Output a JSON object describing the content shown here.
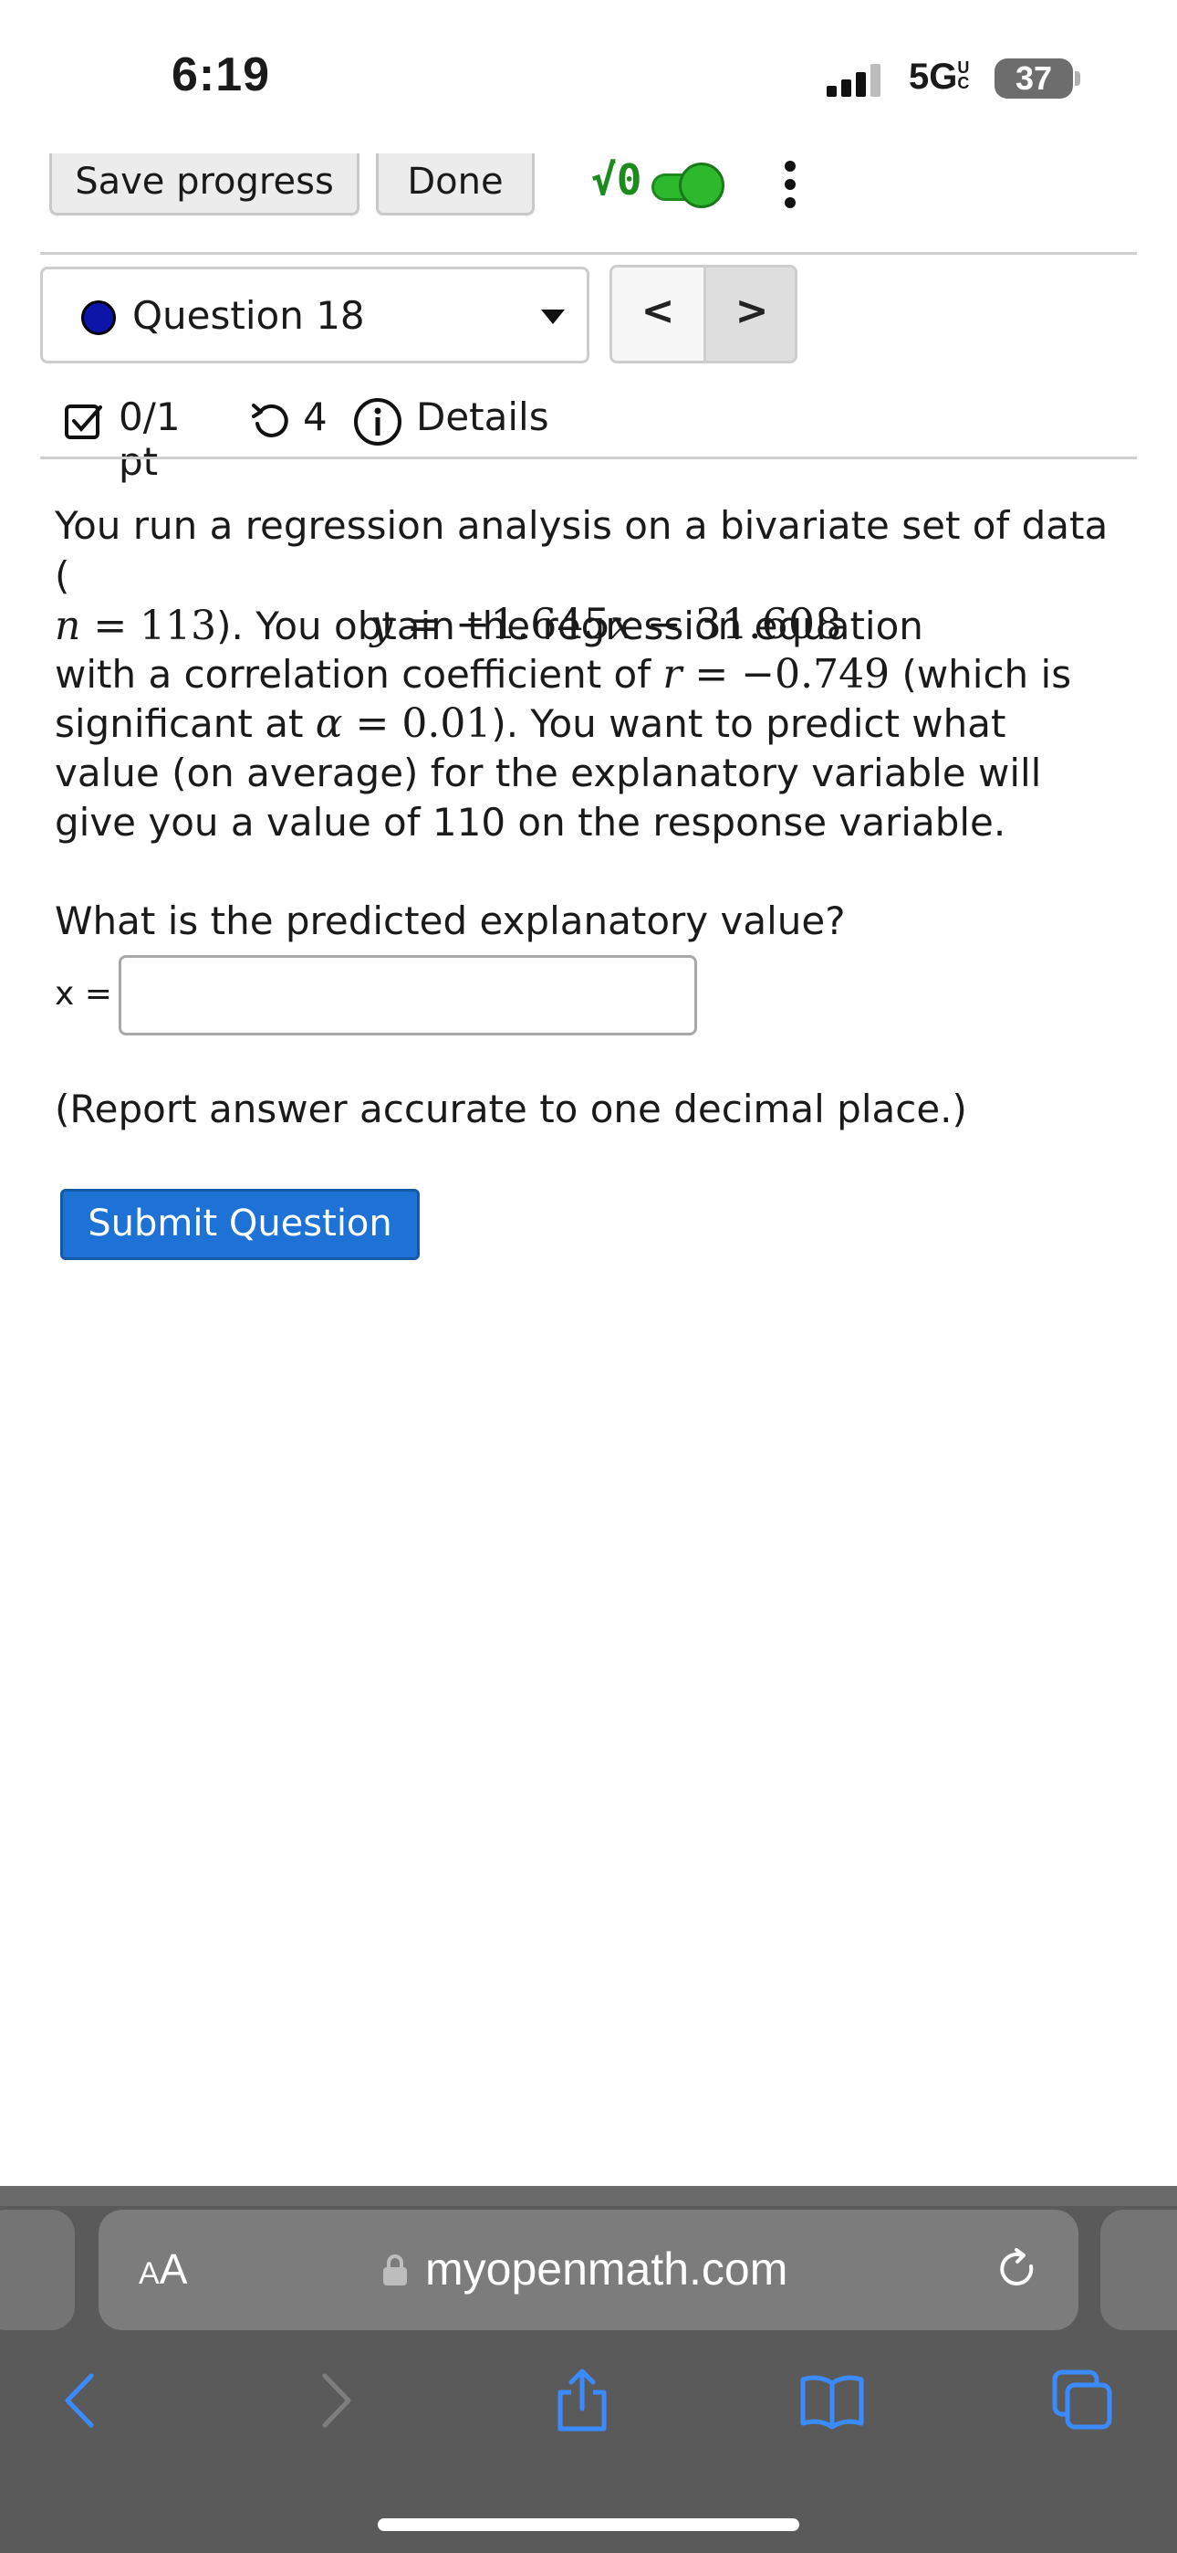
{
  "status_bar": {
    "time": "6:19",
    "network": "5G",
    "network_suffix": "UC",
    "battery": "37"
  },
  "toolbar": {
    "save_label": "Save progress",
    "done_label": "Done",
    "math_toggle_label": "√0",
    "math_toggle_on": true
  },
  "question_nav": {
    "selected": "Question 18",
    "prev_label": "<",
    "next_label": ">"
  },
  "meta": {
    "points": "0/1 pt",
    "tries": "4",
    "details_label": "Details"
  },
  "problem": {
    "p1_a": "You run a regression analysis on a bivariate set of data (",
    "p1_n": "n",
    "p1_eq": " = 113",
    "p1_b": "). You obtain the regression equation",
    "equation_y": "y",
    "equation_rest": " = −1.645",
    "equation_x": "x",
    "equation_tail": " − 31.608",
    "p2_a": "with a correlation coefficient of ",
    "p2_r": "r",
    "p2_rval": " = −0.749",
    "p2_b": " (which is significant at ",
    "p2_alpha": "α",
    "p2_alphaval": " = 0.01",
    "p2_c": "). You want to predict what value (on average) for the explanatory variable will give you a value of 110 on the response variable."
  },
  "question": {
    "prompt": "What is the predicted explanatory value?",
    "x_label": "x =",
    "answer_value": "",
    "report_note": "(Report answer accurate to one decimal place.)",
    "submit_label": "Submit Question"
  },
  "browser": {
    "text_size_label_big": "A",
    "text_size_label_small": "A",
    "url": "myopenmath.com"
  },
  "colors": {
    "accent": "#1e72d6",
    "question_dot": "#0d14a8",
    "toggle_on": "#2eb82e",
    "browser_bar": "#5a5a5a",
    "safari_blue": "#3a8bff"
  }
}
